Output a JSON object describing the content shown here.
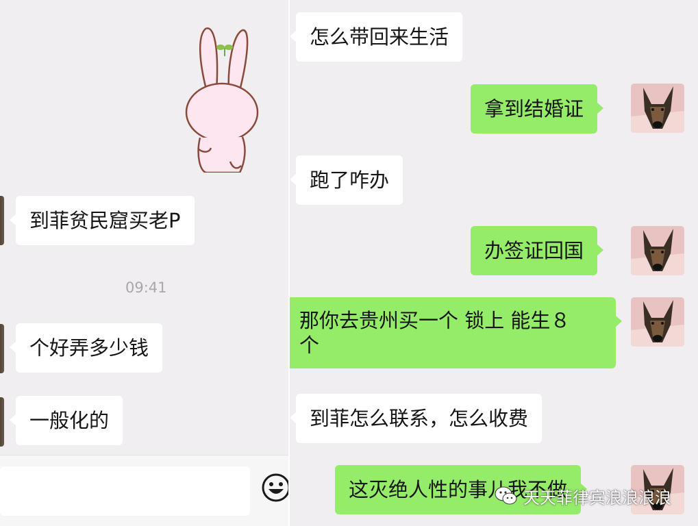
{
  "left_panel": {
    "messages": [
      {
        "text": "到菲贫民窟买老P"
      },
      {
        "text": "个好弄多少钱"
      },
      {
        "text": "一般化的"
      }
    ],
    "timestamp": "09:41"
  },
  "right_panel": {
    "messages": [
      {
        "side": "incoming",
        "text": "怎么带回来生活"
      },
      {
        "side": "outgoing",
        "text": "拿到结婚证"
      },
      {
        "side": "incoming",
        "text": "跑了咋办"
      },
      {
        "side": "outgoing",
        "text": "办签证回国"
      },
      {
        "side": "outgoing",
        "line1": "那你去贵州买一个 锁上 能生８",
        "line2": "个"
      },
      {
        "side": "incoming",
        "text": "到菲怎么联系，怎么收费"
      },
      {
        "side": "outgoing",
        "text": "这灭绝人性的事儿我不做"
      }
    ]
  },
  "watermark": {
    "text": "天天菲律宾浪浪浪浪"
  },
  "icons": {
    "sticker": "bunny-sticker-icon",
    "avatar": "dog-avatar-icon",
    "emoji": "emoji-icon",
    "watermark_logo": "wechat-logo-icon"
  },
  "colors": {
    "chat_background": "#f1eef2",
    "incoming_bubble": "#ffffff",
    "outgoing_bubble": "#95ec69",
    "timestamp": "#a8a8a8"
  }
}
